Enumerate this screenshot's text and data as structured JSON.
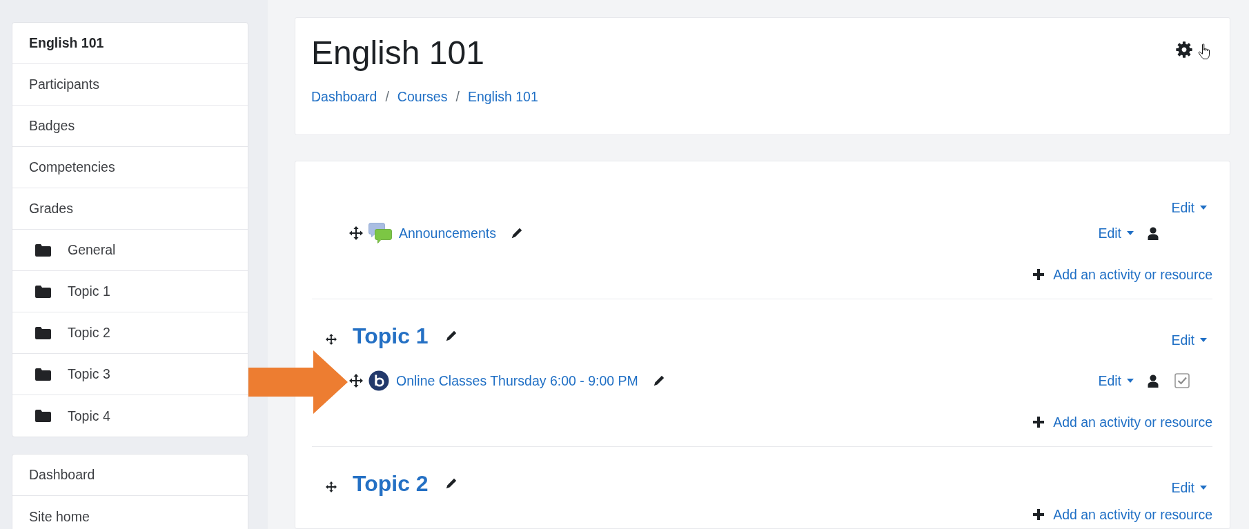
{
  "sidebar": {
    "groups": [
      {
        "items": [
          {
            "label": "English 101",
            "kind": "link",
            "selected": true
          },
          {
            "label": "Participants",
            "kind": "link",
            "selected": false
          },
          {
            "label": "Badges",
            "kind": "link",
            "selected": false
          },
          {
            "label": "Competencies",
            "kind": "link",
            "selected": false
          },
          {
            "label": "Grades",
            "kind": "link",
            "selected": false
          },
          {
            "label": "General",
            "kind": "section",
            "selected": false
          },
          {
            "label": "Topic 1",
            "kind": "section",
            "selected": false
          },
          {
            "label": "Topic 2",
            "kind": "section",
            "selected": false
          },
          {
            "label": "Topic 3",
            "kind": "section",
            "selected": false
          },
          {
            "label": "Topic 4",
            "kind": "section",
            "selected": false
          }
        ]
      },
      {
        "items": [
          {
            "label": "Dashboard",
            "kind": "link",
            "selected": false
          },
          {
            "label": "Site home",
            "kind": "link",
            "selected": false
          }
        ]
      }
    ]
  },
  "header": {
    "title": "English 101",
    "breadcrumb": {
      "items": [
        "Dashboard",
        "Courses",
        "English 101"
      ],
      "separators": [
        "/",
        "/"
      ]
    }
  },
  "sections": [
    {
      "edit_menu": "Edit",
      "activities": [
        {
          "kind": "forum",
          "name": "Announcements",
          "edit_menu": "Edit"
        }
      ],
      "add_link": "Add an activity or resource"
    },
    {
      "title": "Topic 1",
      "edit_menu": "Edit",
      "activities": [
        {
          "kind": "conference",
          "name": "Online Classes Thursday 6:00 - 9:00 PM",
          "edit_menu": "Edit",
          "completion": {
            "checked": true
          }
        }
      ],
      "add_link": "Add an activity or resource"
    },
    {
      "title": "Topic 2",
      "edit_menu": "Edit",
      "add_link": "Add an activity or resource"
    }
  ]
}
